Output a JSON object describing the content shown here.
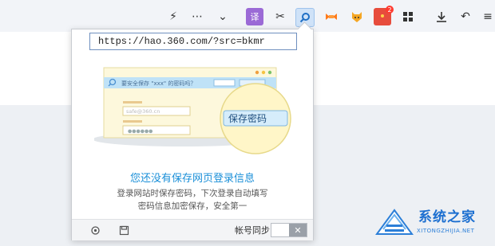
{
  "toolbar": {
    "icons": [
      "lightning-icon",
      "more-icon",
      "chevron-down-icon",
      "translate-extension-icon",
      "scissors-icon",
      "search-icon",
      "game-extension-icon",
      "fox-extension-icon",
      "red-envelope-extension-icon",
      "apps-grid-icon",
      "download-icon",
      "undo-icon",
      "menu-icon"
    ],
    "translate_label": "译",
    "notification_count": "2"
  },
  "popup": {
    "url": "https://hao.360.com/?src=bkmr",
    "illustration": {
      "prompt_text": "要安全保存 \"xxx\" 的密码吗？",
      "sample_email": "safe@360.cn",
      "sample_password": "●●●●●●",
      "save_button": "保存密码"
    },
    "title": "您还没有保存网页登录信息",
    "description_line1": "登录网站时保存密码，下次登录自动填写",
    "description_line2": "密码信息加密保存，安全第一",
    "footer": {
      "sync_label": "帐号同步",
      "toggle_off_glyph": "✕"
    }
  },
  "watermark": {
    "title": "系统之家",
    "url": "XITONGZHIJIA.NET"
  },
  "colors": {
    "accent": "#1a8fd8",
    "illustration_bg": "#fdf8dc",
    "illustration_bar": "#bfe2f7"
  }
}
